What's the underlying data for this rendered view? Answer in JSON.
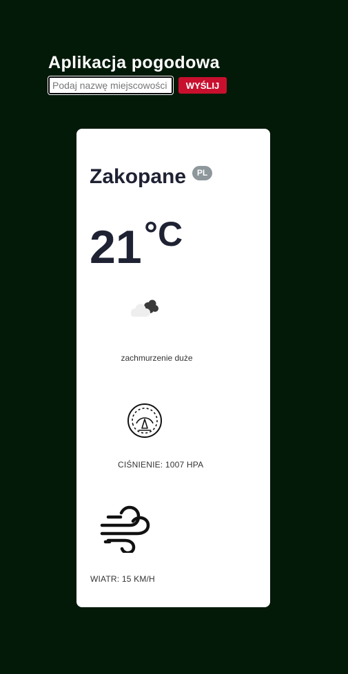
{
  "header": {
    "title": "Aplikacja pogodowa"
  },
  "search": {
    "placeholder": "Podaj nazwę miejscowości",
    "value": "",
    "button_label": "WYŚLIJ"
  },
  "weather": {
    "city": "Zakopane",
    "country_code": "PL",
    "temperature": "21",
    "temperature_unit": "°C",
    "description": "zachmurzenie duże",
    "description_icon": "cloud-icon",
    "pressure_label": "CIŚNIENIE: 1007 HPA",
    "pressure_icon": "gauge-icon",
    "wind_label": "WIATR: 15 KM/H",
    "wind_icon": "wind-icon"
  },
  "colors": {
    "page_background": "#041a09",
    "card_background": "#ffffff",
    "button_background": "#c8102e",
    "badge_background": "#8d979c",
    "text_dark": "#1f2233"
  }
}
